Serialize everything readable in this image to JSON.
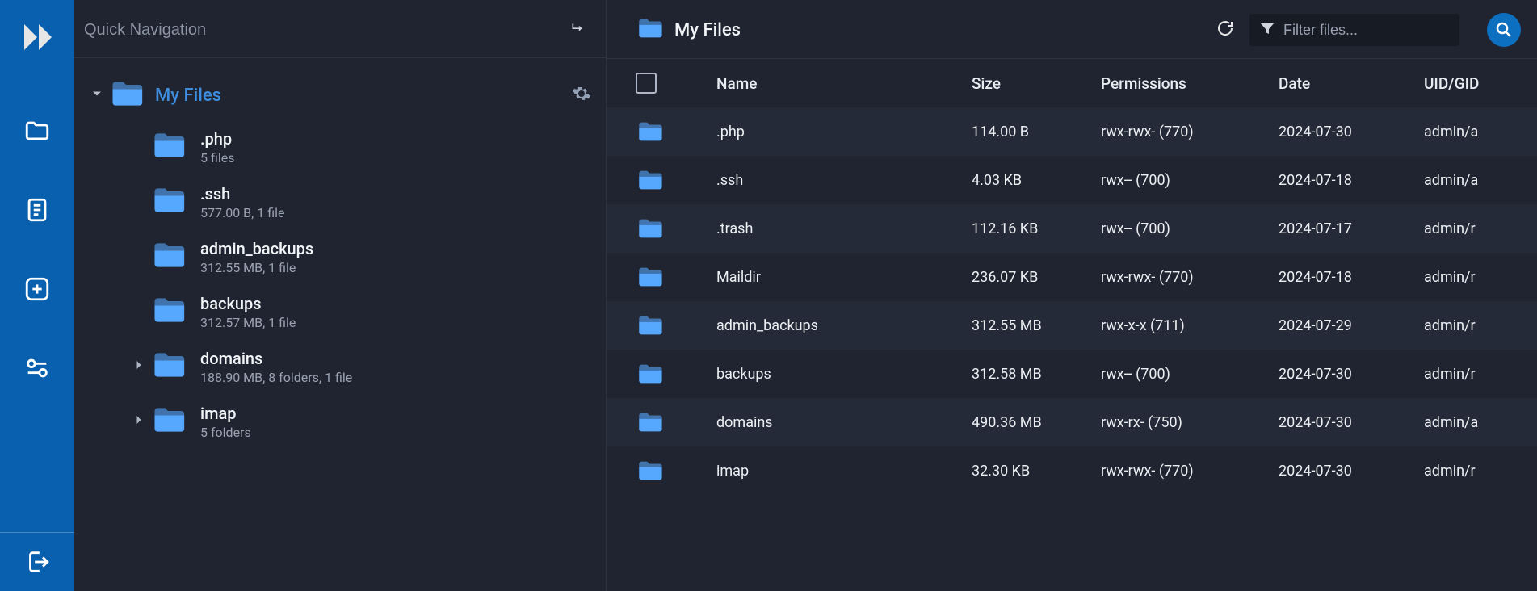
{
  "search_placeholder": "Quick Navigation",
  "root_label": "My Files",
  "breadcrumb_title": "My Files",
  "filter_placeholder": "Filter files...",
  "tree": [
    {
      "name": ".php",
      "sub": "5 files",
      "expandable": false
    },
    {
      "name": ".ssh",
      "sub": "577.00 B, 1 file",
      "expandable": false
    },
    {
      "name": "admin_backups",
      "sub": "312.55 MB, 1 file",
      "expandable": false
    },
    {
      "name": "backups",
      "sub": "312.57 MB, 1 file",
      "expandable": false
    },
    {
      "name": "domains",
      "sub": "188.90 MB, 8 folders, 1 file",
      "expandable": true
    },
    {
      "name": "imap",
      "sub": "5 folders",
      "expandable": true
    }
  ],
  "columns": {
    "name": "Name",
    "size": "Size",
    "perm": "Permissions",
    "date": "Date",
    "uid": "UID/GID"
  },
  "rows": [
    {
      "name": ".php",
      "size": "114.00 B",
      "perm": "rwx-rwx- (770)",
      "date": "2024-07-30",
      "uid": "admin/a"
    },
    {
      "name": ".ssh",
      "size": "4.03 KB",
      "perm": "rwx-- (700)",
      "date": "2024-07-18",
      "uid": "admin/a"
    },
    {
      "name": ".trash",
      "size": "112.16 KB",
      "perm": "rwx-- (700)",
      "date": "2024-07-17",
      "uid": "admin/r"
    },
    {
      "name": "Maildir",
      "size": "236.07 KB",
      "perm": "rwx-rwx- (770)",
      "date": "2024-07-18",
      "uid": "admin/r"
    },
    {
      "name": "admin_backups",
      "size": "312.55 MB",
      "perm": "rwx-x-x (711)",
      "date": "2024-07-29",
      "uid": "admin/r"
    },
    {
      "name": "backups",
      "size": "312.58 MB",
      "perm": "rwx-- (700)",
      "date": "2024-07-30",
      "uid": "admin/r"
    },
    {
      "name": "domains",
      "size": "490.36 MB",
      "perm": "rwx-rx- (750)",
      "date": "2024-07-30",
      "uid": "admin/a"
    },
    {
      "name": "imap",
      "size": "32.30 KB",
      "perm": "rwx-rwx- (770)",
      "date": "2024-07-30",
      "uid": "admin/r"
    }
  ]
}
